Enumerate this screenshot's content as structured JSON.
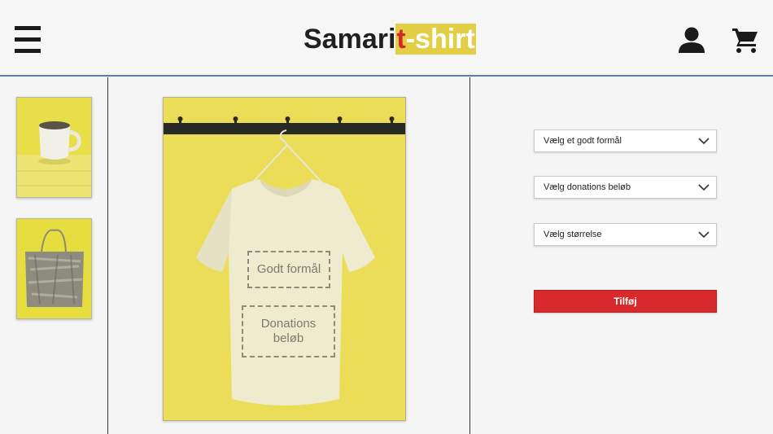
{
  "header": {
    "logo_part1": "Samari",
    "logo_t": "t",
    "logo_part2": "-shirt",
    "icons": [
      "menu-icon",
      "user-icon",
      "cart-icon"
    ]
  },
  "thumbnails": [
    {
      "name": "mug",
      "icon": "mug-image"
    },
    {
      "name": "tote-bag",
      "icon": "tote-bag-image"
    }
  ],
  "product": {
    "zone_purpose": "Godt formål",
    "zone_donation_line1": "Donations",
    "zone_donation_line2": "beløb"
  },
  "options": {
    "purpose_select": "Vælg et godt formål",
    "donation_select": "Vælg donations beløb",
    "size_select": "Vælg størrelse",
    "add_button": "Tilføj"
  },
  "colors": {
    "accent_yellow": "#e2cf45",
    "accent_red": "#d8292c",
    "header_border": "#5a7fa6"
  }
}
